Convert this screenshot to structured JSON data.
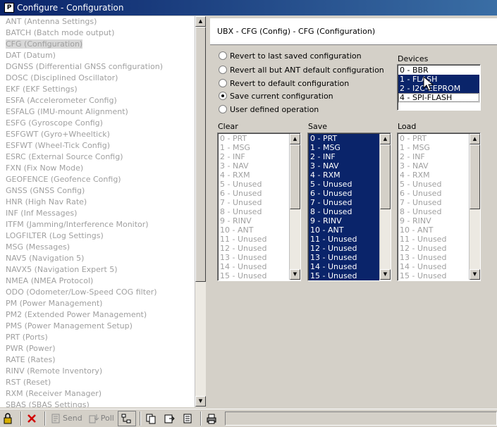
{
  "window": {
    "title": "Configure - Configuration",
    "icon_letter": "P"
  },
  "messages": [
    "ANT (Antenna Settings)",
    "BATCH (Batch mode output)",
    "CFG (Configuration)",
    "DAT (Datum)",
    "DGNSS (Differential GNSS configuration)",
    "DOSC (Disciplined Oscillator)",
    "EKF (EKF Settings)",
    "ESFA (Accelerometer Config)",
    "ESFALG (IMU-mount Alignment)",
    "ESFG (Gyroscope Config)",
    "ESFGWT (Gyro+Wheeltick)",
    "ESFWT (Wheel-Tick Config)",
    "ESRC (External Source Config)",
    "FXN (Fix Now Mode)",
    "GEOFENCE (Geofence Config)",
    "GNSS (GNSS Config)",
    "HNR (High Nav Rate)",
    "INF (Inf Messages)",
    "ITFM (Jamming/Interference Monitor)",
    "LOGFILTER (Log Settings)",
    "MSG (Messages)",
    "NAV5 (Navigation 5)",
    "NAVX5 (Navigation Expert 5)",
    "NMEA (NMEA Protocol)",
    "ODO (Odometer/Low-Speed COG filter)",
    "PM (Power Management)",
    "PM2 (Extended Power Management)",
    "PMS (Power Management Setup)",
    "PRT (Ports)",
    "PWR (Power)",
    "RATE (Rates)",
    "RINV (Remote Inventory)",
    "RST (Reset)",
    "RXM (Receiver Manager)",
    "SBAS (SBAS Settings)"
  ],
  "selected_message": "CFG (Configuration)",
  "panel": {
    "title": "UBX - CFG (Config) - CFG (Configuration)",
    "options": [
      {
        "label": "Revert to last saved configuration",
        "checked": false
      },
      {
        "label": "Revert all but ANT default configuration",
        "checked": false
      },
      {
        "label": "Revert to default configuration",
        "checked": false
      },
      {
        "label": "Save current configuration",
        "checked": true
      },
      {
        "label": "User defined operation",
        "checked": false
      }
    ],
    "devices_label": "Devices",
    "devices": [
      {
        "label": "0 - BBR",
        "selected": false
      },
      {
        "label": "1 - FLASH",
        "selected": true
      },
      {
        "label": "2 - I2C-EEPROM",
        "selected": true
      },
      {
        "label": "4 - SPI-FLASH",
        "selected": false
      }
    ],
    "clear_label": "Clear",
    "save_label": "Save",
    "load_label": "Load",
    "sections": [
      "0 - PRT",
      "1 - MSG",
      "2 - INF",
      "3 - NAV",
      "4 - RXM",
      "5 - Unused",
      "6 - Unused",
      "7 - Unused",
      "8 - Unused",
      "9 - RINV",
      "10 - ANT",
      "11 - Unused",
      "12 - Unused",
      "13 - Unused",
      "14 - Unused",
      "15 - Unused"
    ]
  },
  "toolbar": {
    "send_label": "Send",
    "poll_label": "Poll"
  },
  "colors": {
    "selection": "#0a246a",
    "disabled_text": "#a0a0a0",
    "face": "#d4d0c8"
  }
}
